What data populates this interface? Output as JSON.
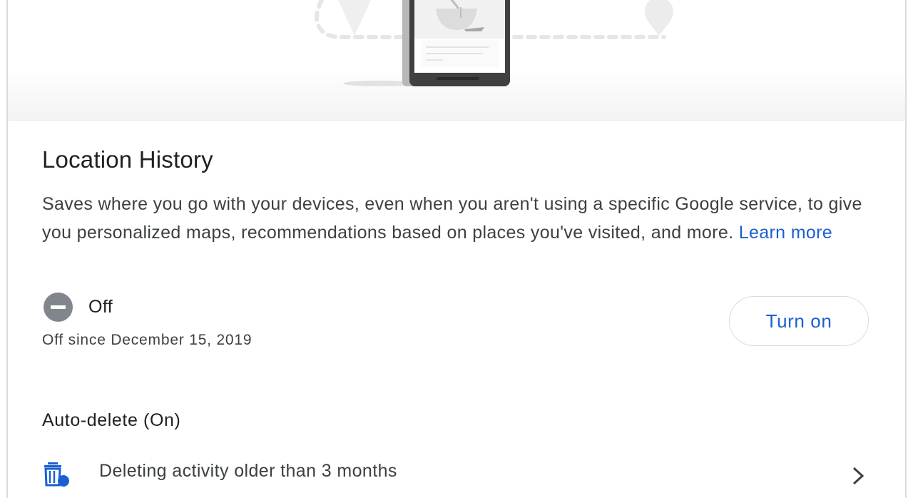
{
  "section": {
    "title": "Location History",
    "description": "Saves where you go with your devices, even when you aren't using a specific Google service, to give you personalized maps, recommendations based on places you've visited, and more.",
    "learn_more_label": "Learn more"
  },
  "status": {
    "icon": "remove-circle-icon",
    "label": "Off",
    "since": "Off since December 15, 2019",
    "turn_on_label": "Turn on"
  },
  "auto_delete": {
    "title": "Auto-delete (On)",
    "icon": "delete-schedule-icon",
    "text": "Deleting activity older than 3 months",
    "chevron": "chevron-right-icon"
  },
  "colors": {
    "accent": "#1a5fd1",
    "status_icon": "#80868b",
    "border": "#dadce0"
  }
}
